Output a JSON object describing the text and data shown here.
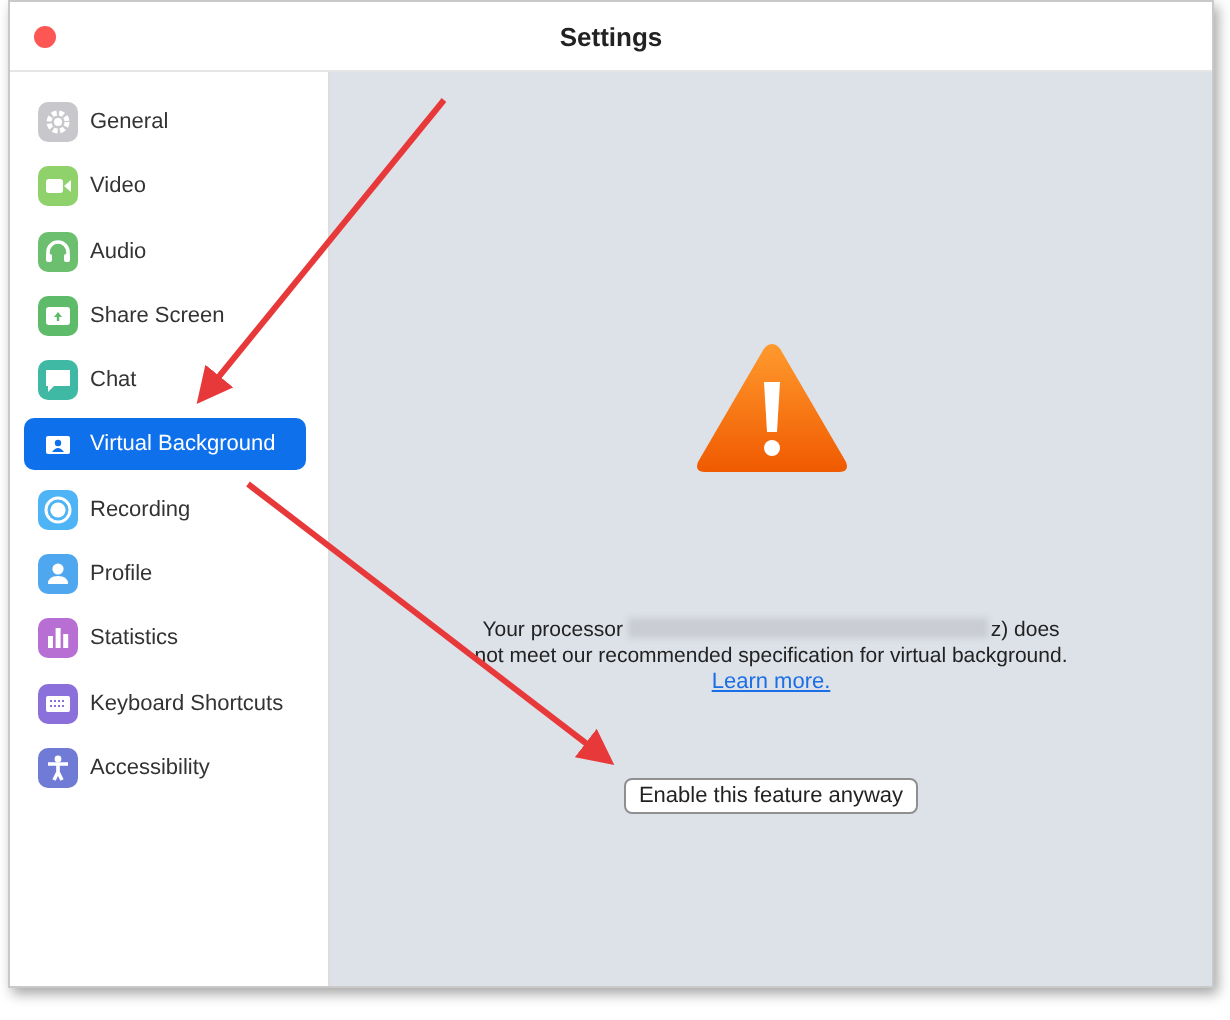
{
  "window": {
    "title": "Settings"
  },
  "sidebar": {
    "items": [
      {
        "label": "General",
        "selected": false,
        "color": "#c7c7cc"
      },
      {
        "label": "Video",
        "selected": false,
        "color": "#8fd26b"
      },
      {
        "label": "Audio",
        "selected": false,
        "color": "#6cbf6f"
      },
      {
        "label": "Share Screen",
        "selected": false,
        "color": "#5dbb69"
      },
      {
        "label": "Chat",
        "selected": false,
        "color": "#3fb9a3"
      },
      {
        "label": "Virtual Background",
        "selected": true,
        "color": "#ffffff"
      },
      {
        "label": "Recording",
        "selected": false,
        "color": "#4fb4f5"
      },
      {
        "label": "Profile",
        "selected": false,
        "color": "#4ea7ef"
      },
      {
        "label": "Statistics",
        "selected": false,
        "color": "#b76fd4"
      },
      {
        "label": "Keyboard Shortcuts",
        "selected": false,
        "color": "#8b70db"
      },
      {
        "label": "Accessibility",
        "selected": false,
        "color": "#707bd6"
      }
    ]
  },
  "notice": {
    "message_start": "Your processor",
    "message_end": "z) does not meet our recommended specification for virtual background.",
    "link": "Learn more.",
    "button": "Enable this feature anyway"
  }
}
